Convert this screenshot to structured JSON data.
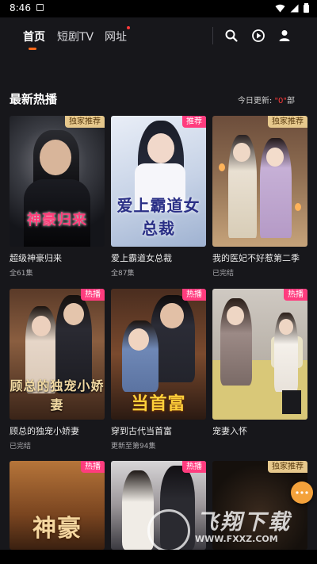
{
  "status_bar": {
    "time": "8:46"
  },
  "nav": {
    "tabs": [
      {
        "label": "首页",
        "active": true
      },
      {
        "label": "短剧TV",
        "active": false
      },
      {
        "label": "网址",
        "active": false
      }
    ],
    "accent_color": "#ff6a1a",
    "icons": [
      "search-icon",
      "play-history-icon",
      "user-icon"
    ]
  },
  "section": {
    "title": "最新热播",
    "update_prefix": "今日更新: ",
    "update_count": "\"0\"",
    "update_suffix": "部"
  },
  "cards": [
    {
      "title": "超级神豪归来",
      "sub": "全61集",
      "badge": "独家推荐",
      "badge_type": "exclusive",
      "poster_text": "神豪归来"
    },
    {
      "title": "爱上霸道女总裁",
      "sub": "全87集",
      "badge": "推荐",
      "badge_type": "hot",
      "poster_text": "爱上霸道女总裁"
    },
    {
      "title": "我的医妃不好惹第二季",
      "sub": "已完结",
      "badge": "独家推荐",
      "badge_type": "exclusive",
      "poster_text": ""
    },
    {
      "title": "顾总的独宠小娇妻",
      "sub": "已完结",
      "badge": "热播",
      "badge_type": "hot",
      "poster_text": "顾总的独宠小娇妻"
    },
    {
      "title": "穿到古代当首富",
      "sub": "更新至第94集",
      "badge": "热播",
      "badge_type": "hot",
      "poster_text": "当首富"
    },
    {
      "title": "宠妻入怀",
      "sub": "",
      "badge": "热播",
      "badge_type": "hot",
      "poster_text": ""
    },
    {
      "title": "",
      "sub": "",
      "badge": "热播",
      "badge_type": "hot",
      "poster_text": "神豪"
    },
    {
      "title": "",
      "sub": "",
      "badge": "热播",
      "badge_type": "hot",
      "poster_text": ""
    },
    {
      "title": "",
      "sub": "",
      "badge": "独家推荐",
      "badge_type": "exclusive",
      "poster_text": ""
    }
  ],
  "watermark": {
    "title": "飞翔下载",
    "url": "WWW.FXXZ.COM"
  }
}
